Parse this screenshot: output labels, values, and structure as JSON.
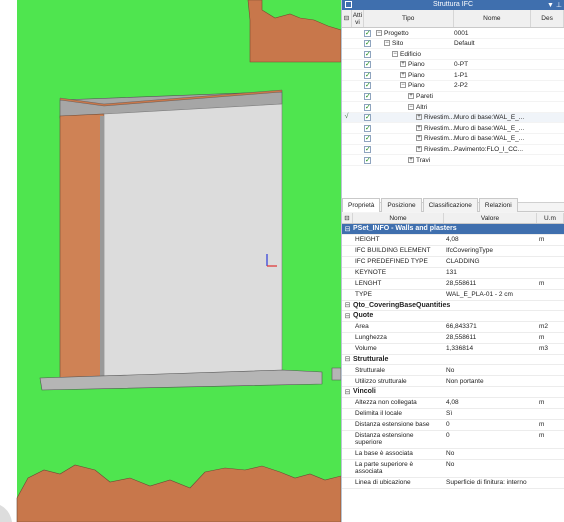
{
  "tree": {
    "title": "Struttura IFC",
    "header": {
      "attivi": "Atti vi",
      "tipo": "Tipo",
      "nome": "Nome",
      "desc": "Des"
    },
    "rows": [
      {
        "indent": 0,
        "exp": "−",
        "tipo": "Progetto",
        "nome": "0001"
      },
      {
        "indent": 1,
        "exp": "−",
        "tipo": "Sito",
        "nome": "Default"
      },
      {
        "indent": 2,
        "exp": "−",
        "tipo": "Edificio",
        "nome": ""
      },
      {
        "indent": 3,
        "exp": "+",
        "tipo": "Piano",
        "nome": "0-PT"
      },
      {
        "indent": 3,
        "exp": "+",
        "tipo": "Piano",
        "nome": "1-P1"
      },
      {
        "indent": 3,
        "exp": "−",
        "tipo": "Piano",
        "nome": "2-P2"
      },
      {
        "indent": 4,
        "exp": "+",
        "tipo": "Pareti",
        "nome": ""
      },
      {
        "indent": 4,
        "exp": "−",
        "tipo": "Altri",
        "nome": ""
      },
      {
        "indent": 5,
        "exp": "+",
        "tipo": "Rivestim...",
        "nome": "Muro di base:WAL_E_...",
        "active": true
      },
      {
        "indent": 5,
        "exp": "+",
        "tipo": "Rivestim...",
        "nome": "Muro di base:WAL_E_..."
      },
      {
        "indent": 5,
        "exp": "+",
        "tipo": "Rivestim...",
        "nome": "Muro di base:WAL_E_..."
      },
      {
        "indent": 5,
        "exp": "+",
        "tipo": "Rivestim...",
        "nome": "Pavimento:FLO_I_CC..."
      },
      {
        "indent": 4,
        "exp": "+",
        "tipo": "Travi",
        "nome": ""
      }
    ]
  },
  "tabs": [
    "Proprietà",
    "Posizione",
    "Classificazione",
    "Relazioni"
  ],
  "props": {
    "header": {
      "nome": "Nome",
      "valore": "Valore",
      "um": "U.m"
    },
    "sections": [
      {
        "title": "PSet_INFO - Walls and plasters",
        "highlight": true,
        "rows": [
          {
            "n": "HEIGHT",
            "v": "4,08",
            "u": "m"
          },
          {
            "n": "IFC BUILDING ELEMENT",
            "v": "IfcCoveringType",
            "u": ""
          },
          {
            "n": "IFC PREDEFINED TYPE",
            "v": "CLADDING",
            "u": ""
          },
          {
            "n": "KEYNOTE",
            "v": "131",
            "u": ""
          },
          {
            "n": "LENGHT",
            "v": "28,558611",
            "u": "m"
          },
          {
            "n": "TYPE",
            "v": "WAL_E_PLA-01 - 2 cm",
            "u": ""
          }
        ]
      },
      {
        "title": "Qto_CoveringBaseQuantities",
        "rows": []
      },
      {
        "title": "Quote",
        "rows": [
          {
            "n": "Area",
            "v": "66,843371",
            "u": "m2"
          },
          {
            "n": "Lunghezza",
            "v": "28,558611",
            "u": "m"
          },
          {
            "n": "Volume",
            "v": "1,336814",
            "u": "m3"
          }
        ]
      },
      {
        "title": "Strutturale",
        "rows": [
          {
            "n": "Strutturale",
            "v": "No",
            "u": ""
          },
          {
            "n": "Utilizzo strutturale",
            "v": "Non portante",
            "u": ""
          }
        ]
      },
      {
        "title": "Vincoli",
        "rows": [
          {
            "n": "Altezza non collegata",
            "v": "4,08",
            "u": "m"
          },
          {
            "n": "Delimita il locale",
            "v": "Sì",
            "u": ""
          },
          {
            "n": "Distanza estensione base",
            "v": "0",
            "u": "m"
          },
          {
            "n": "Distanza estensione superiore",
            "v": "0",
            "u": "m"
          },
          {
            "n": "La base è associata",
            "v": "No",
            "u": ""
          },
          {
            "n": "La parte superiore è associata",
            "v": "No",
            "u": ""
          },
          {
            "n": "Linea di ubicazione",
            "v": "Superficie di finitura: interno",
            "u": ""
          }
        ]
      }
    ]
  },
  "colors": {
    "viewport_bg": "#4fe54f",
    "terrain": "#c8774b",
    "wall_face": "#dcdcdc",
    "header_blue": "#3f6fae"
  }
}
